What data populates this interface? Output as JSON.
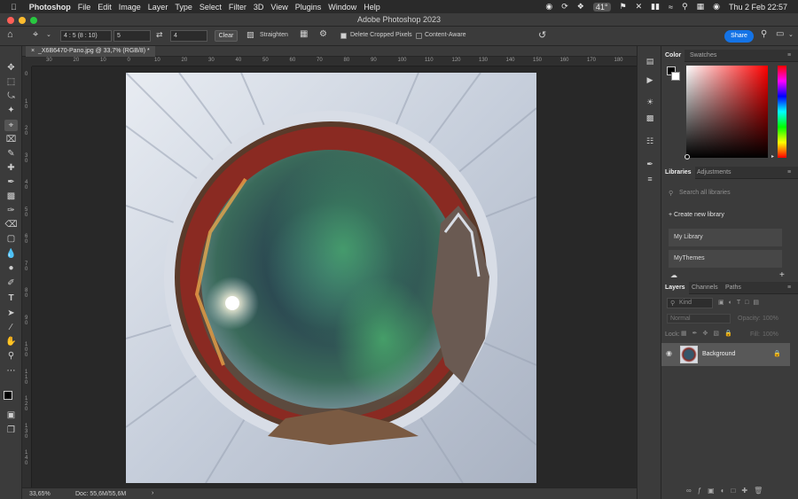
{
  "menubar": {
    "app_name": "Photoshop",
    "items": [
      "File",
      "Edit",
      "Image",
      "Layer",
      "Type",
      "Select",
      "Filter",
      "3D",
      "View",
      "Plugins",
      "Window",
      "Help"
    ],
    "status_temp": "41°",
    "clock": "Thu 2 Feb  22:57"
  },
  "window": {
    "title": "Adobe Photoshop 2023"
  },
  "options": {
    "ratio_select": "4 : 5 (8 : 10)",
    "width_value": "5",
    "height_value": "4",
    "clear_label": "Clear",
    "straighten_label": "Straighten",
    "delete_cropped_label": "Delete Cropped Pixels",
    "content_aware_label": "Content-Aware",
    "share_label": "Share"
  },
  "document": {
    "tab_title": "_X6B6470-Pano.jpg @ 33,7% (RGB/8) *",
    "zoom": "33,65%",
    "doc_size": "Doc: 55,6M/55,6M"
  },
  "ruler": {
    "h_ticks": [
      "30",
      "20",
      "10",
      "0",
      "10",
      "20",
      "30",
      "40",
      "50",
      "60",
      "70",
      "80",
      "90",
      "100",
      "110",
      "120",
      "130",
      "140",
      "150",
      "160",
      "170",
      "180"
    ],
    "v_ticks": [
      "0",
      "1 0",
      "2 0",
      "3 0",
      "4 0",
      "5 0",
      "6 0",
      "7 0",
      "8 0",
      "9 0",
      "1 0 0",
      "1 1 0",
      "1 2 0",
      "1 3 0",
      "1 4 0"
    ]
  },
  "color_panel": {
    "tabs": [
      "Color",
      "Swatches"
    ],
    "hue_color": "#ff0000"
  },
  "libraries_panel": {
    "tabs": [
      "Libraries",
      "Adjustments"
    ],
    "search_placeholder": "Search all libraries",
    "create_label": "Create new library",
    "items": [
      "My Library",
      "MyThemes"
    ]
  },
  "layers_panel": {
    "tabs": [
      "Layers",
      "Channels",
      "Paths"
    ],
    "kind_label": "Kind",
    "blend_mode": "Normal",
    "opacity_label": "Opacity:",
    "opacity_value": "100%",
    "lock_label": "Lock:",
    "fill_label": "Fill:",
    "fill_value": "100%",
    "layer_name": "Background"
  },
  "colors": {
    "accent": "#1473e6",
    "panel_bg": "#3b3b3b",
    "canvas_bg": "#282828"
  }
}
